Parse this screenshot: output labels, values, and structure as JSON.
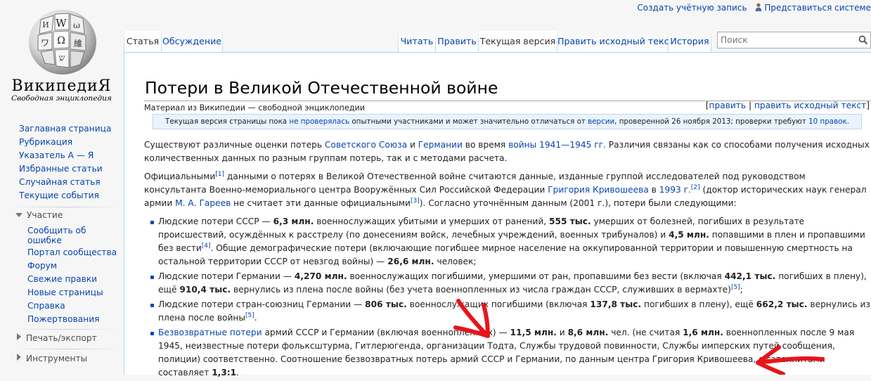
{
  "personal": {
    "create_account": "Создать учётную запись",
    "login": "Представиться системе"
  },
  "logo": {
    "wordmark": "ВикипедиЯ",
    "tagline": "Свободная энциклопедия"
  },
  "sidebar": {
    "navigation": [
      "Заглавная страница",
      "Рубрикация",
      "Указатель А — Я",
      "Избранные статьи",
      "Случайная статья",
      "Текущие события"
    ],
    "participation": {
      "label": "Участие",
      "items": [
        "Сообщить об ошибке",
        "Портал сообщества",
        "Форум",
        "Свежие правки",
        "Новые страницы",
        "Справка",
        "Пожертвования"
      ]
    },
    "print_export": "Печать/экспорт",
    "tools": "Инструменты"
  },
  "tabs": {
    "article": "Статья",
    "discussion": "Обсуждение",
    "read": "Читать",
    "edit": "Править",
    "current_version": "Текущая версия",
    "edit_source": "Править исходный текст",
    "history": "История"
  },
  "search": {
    "placeholder": "Поиск"
  },
  "page": {
    "title": "Потери в Великой Отечественной войне",
    "site_sub": "Материал из Википедии — свободной энциклопедии",
    "edit_links": {
      "open": "[",
      "edit": "править",
      "sep": " | ",
      "edit_source": "править исходный текст",
      "close": "]"
    },
    "flagged": {
      "t1": "Текущая версия страницы пока ",
      "l1": "не проверялась",
      "t2": " опытными участниками и может значительно отличаться от ",
      "l2": "версии",
      "t3": ", проверенной 26 ноября 2013; проверки требуют ",
      "l3": "10 правок",
      "t4": "."
    },
    "p1": {
      "t1": "Существуют различные оценки потерь ",
      "l1": "Советского Союза",
      "t2": " и ",
      "l2": "Германии",
      "t3": " во время ",
      "l3": "войны 1941—1945 гг.",
      "t4": " Различия связаны как со способами получения исходных количественных данных по разным группам потерь, так и с методами расчета."
    },
    "p2": {
      "t1": "Официальными",
      "s1": "[1]",
      "t2": " данными о потерях в Великой Отечественной войне считаются данные, изданные группой исследователей под руководством консультанта Военно-мемориального центра Вооружённых Сил Российской Федерации ",
      "l1": "Григория Кривошеева",
      "t3": " в ",
      "l2": "1993 г.",
      "s2": "[2]",
      "t4": " (доктор исторических наук генерал армии ",
      "l3": "М. А. Гареев",
      "t5": " не считает эти данные официальными",
      "s3": "[3]",
      "t6": "). Согласно уточнённым данным (2001 г.), потери были следующими:"
    },
    "list": {
      "i1": {
        "t1": "Людские потери СССР — ",
        "b1": "6,3 млн.",
        "t2": " военнослужащих убитыми и умерших от ранений, ",
        "b2": "555 тыс.",
        "t3": " умерших от болезней, погибших в результате происшествий, осуждённых к расстрелу (по донесениям войск, лечебных учреждений, военных трибуналов) и ",
        "b3": "4,5 млн.",
        "t4": " попавшими в плен и пропавшими без вести",
        "s1": "[4]",
        "t5": ". Общие демографические потери (включающие погибшее мирное население на оккупированной территории и повышенную смертность на остальной территории СССР от невзгод войны) — ",
        "b4": "26,6 млн.",
        "t6": " человек;"
      },
      "i2": {
        "t1": "Людские потери Германии — ",
        "b1": "4,270 млн.",
        "t2": " военнослужащих погибшими, умершими от ран, пропавшими без вести (включая ",
        "b2": "442,1 тыс.",
        "t3": " погибших в плену), ещё ",
        "b3": "910,4 тыс.",
        "t4": " вернулись из плена после войны (без учета военнопленных из числа граждан СССР, служивших в вермахте)",
        "s1": "[5]",
        "t5": ";"
      },
      "i3": {
        "t1": "Людские потери стран-союзниц Германии — ",
        "b1": "806 тыс.",
        "t2": " военнослужащих погибшими (включая ",
        "b2": "137,8 тыс.",
        "t3": " погибших в плену), ещё ",
        "b3": "662,2 тыс.",
        "t4": " вернулись из плена после войны",
        "s1": "[5]",
        "t5": "."
      },
      "i4": {
        "l1": "Безвозвратные потери",
        "t1": " армий СССР и Германии (включая военнопленных) — ",
        "b1": "11,5 млн.",
        "t2": " и ",
        "b2": "8,6 млн.",
        "t3": " чел. (не считая ",
        "b3": "1,6 млн.",
        "t4": " военнопленных после 9 мая 1945, неизвестные потери фольксштурма, Гитлерюгенда, организации Тодта, Службы трудовой повинности, Службы имперских путей сообщения, полиции) соответственно. Соотношение безвозвратных потерь армий СССР и Германии, по данным центра Григория Кривошеева, с сателлитами составляет ",
        "b4": "1,3:1",
        "t5": "."
      }
    }
  },
  "colors": {
    "link": "#0645ad",
    "tab_border": "#a7d7f9",
    "flagged_bg": "#eaf3ff",
    "annotation_arrow": "#e8141b"
  },
  "icons": [
    "user-icon",
    "search-icon",
    "wikipedia-globe-icon",
    "triangle-down-icon",
    "triangle-right-icon"
  ]
}
